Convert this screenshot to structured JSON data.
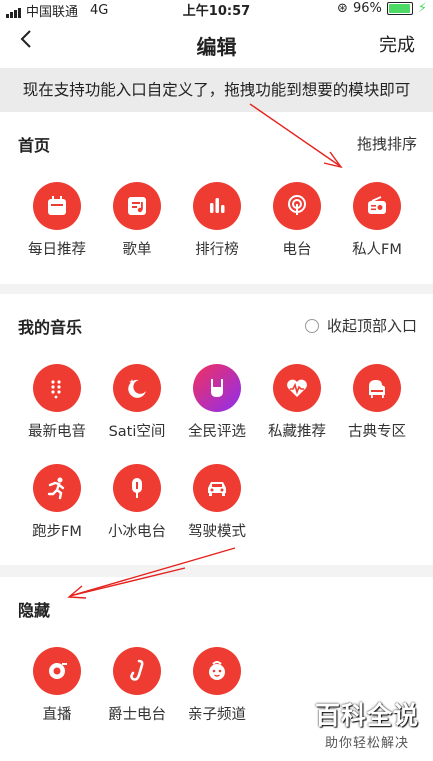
{
  "status_bar": {
    "carrier": "中国联通",
    "network": "4G",
    "time": "上午10:57",
    "battery": "96%",
    "battery_level": 0.96
  },
  "header": {
    "title": "编辑",
    "done_label": "完成"
  },
  "notice": "现在支持功能入口自定义了，拖拽功能到想要的模块即可",
  "home": {
    "title": "首页",
    "action": "拖拽排序",
    "items": [
      {
        "label": "每日推荐",
        "icon": "calendar-icon"
      },
      {
        "label": "歌单",
        "icon": "playlist-icon"
      },
      {
        "label": "排行榜",
        "icon": "chart-icon"
      },
      {
        "label": "电台",
        "icon": "podcast-icon"
      },
      {
        "label": "私人FM",
        "icon": "radio-icon"
      }
    ]
  },
  "music": {
    "title": "我的音乐",
    "action": "收起顶部入口",
    "items": [
      {
        "label": "最新电音",
        "icon": "dots-icon"
      },
      {
        "label": "Sati空间",
        "icon": "moon-icon"
      },
      {
        "label": "全民评选",
        "icon": "rock-hand-icon"
      },
      {
        "label": "私藏推荐",
        "icon": "heart-wave-icon"
      },
      {
        "label": "古典专区",
        "icon": "piano-icon"
      },
      {
        "label": "跑步FM",
        "icon": "runner-icon"
      },
      {
        "label": "小冰电台",
        "icon": "popsicle-icon"
      },
      {
        "label": "驾驶模式",
        "icon": "car-icon"
      }
    ]
  },
  "hidden": {
    "title": "隐藏",
    "items": [
      {
        "label": "直播",
        "icon": "live-icon"
      },
      {
        "label": "爵士电台",
        "icon": "saxophone-icon"
      },
      {
        "label": "亲子频道",
        "icon": "baby-icon"
      }
    ]
  },
  "watermark": {
    "title": "百科全说",
    "subtitle": "助你轻松解决"
  },
  "colors": {
    "accent": "#ee3c32",
    "background": "#f3f3f3"
  }
}
